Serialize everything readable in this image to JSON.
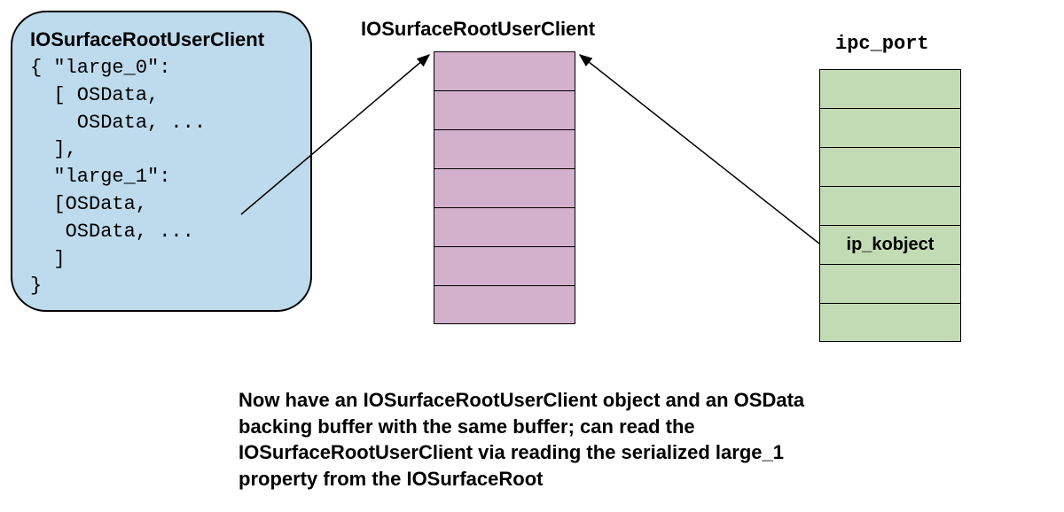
{
  "left_box": {
    "title": "IOSurfaceRootUserClient",
    "code": "{ \"large_0\":\n  [ OSData,\n    OSData, ...\n  ],\n  \"large_1\":\n  [OSData,\n   OSData, ...\n  ]\n}"
  },
  "middle": {
    "title": "IOSurfaceRootUserClient"
  },
  "right": {
    "title": "ipc_port",
    "ip_label": "ip_kobject"
  },
  "caption": "Now have an IOSurfaceRootUserClient object and an OSData backing buffer with the same buffer; can read the IOSurfaceRootUserClient via reading the serialized large_1 property from the IOSurfaceRoot"
}
